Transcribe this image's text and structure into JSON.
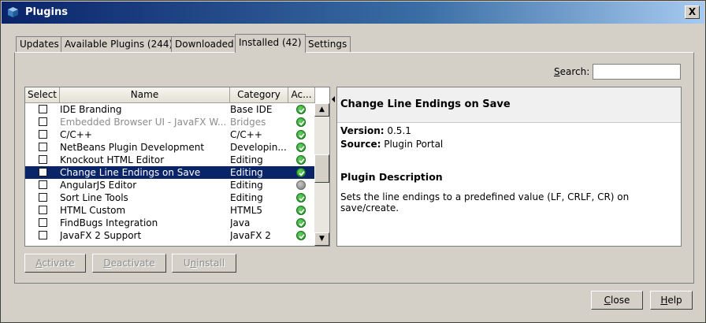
{
  "window": {
    "title": "Plugins",
    "close_label": "X"
  },
  "tabs": [
    {
      "label": "Updates"
    },
    {
      "label": "Available Plugins (244)"
    },
    {
      "label": "Downloaded"
    },
    {
      "label": "Installed (42)"
    },
    {
      "label": "Settings"
    }
  ],
  "search": {
    "label_pre": "",
    "label_mnemonic": "S",
    "label_post": "earch:",
    "value": ""
  },
  "table": {
    "headers": [
      "Select",
      "Name",
      "Category",
      "Ac..."
    ],
    "rows": [
      {
        "name": "IDE Branding",
        "category": "Base IDE",
        "active": true,
        "dimmed": false,
        "selected": false
      },
      {
        "name": "Embedded Browser UI - JavaFX W...",
        "category": "Bridges",
        "active": true,
        "dimmed": true,
        "selected": false
      },
      {
        "name": "C/C++",
        "category": "C/C++",
        "active": true,
        "dimmed": false,
        "selected": false
      },
      {
        "name": "NetBeans Plugin Development",
        "category": "Developin...",
        "active": true,
        "dimmed": false,
        "selected": false
      },
      {
        "name": "Knockout HTML Editor",
        "category": "Editing",
        "active": true,
        "dimmed": false,
        "selected": false
      },
      {
        "name": "Change Line Endings on Save",
        "category": "Editing",
        "active": true,
        "dimmed": false,
        "selected": true
      },
      {
        "name": "AngularJS Editor",
        "category": "Editing",
        "active": false,
        "dimmed": false,
        "selected": false
      },
      {
        "name": "Sort Line Tools",
        "category": "Editing",
        "active": true,
        "dimmed": false,
        "selected": false
      },
      {
        "name": "HTML Custom",
        "category": "HTML5",
        "active": true,
        "dimmed": false,
        "selected": false
      },
      {
        "name": "FindBugs Integration",
        "category": "Java",
        "active": true,
        "dimmed": false,
        "selected": false
      },
      {
        "name": "JavaFX 2 Support",
        "category": "JavaFX 2",
        "active": true,
        "dimmed": false,
        "selected": false
      }
    ]
  },
  "details": {
    "title": "Change Line Endings on Save",
    "version_label": "Version:",
    "version_value": "0.5.1",
    "source_label": "Source:",
    "source_value": "Plugin Portal",
    "section_title": "Plugin Description",
    "description": "Sets the line endings to a predefined value (LF, CRLF, CR) on save/create."
  },
  "actions": {
    "activate": {
      "mnemonic": "A",
      "rest": "ctivate"
    },
    "deactivate": {
      "mnemonic": "D",
      "rest": "eactivate"
    },
    "uninstall": {
      "pre": "U",
      "mnemonic": "n",
      "rest": "install"
    }
  },
  "footer": {
    "close": {
      "mnemonic": "C",
      "rest": "lose"
    },
    "help": {
      "mnemonic": "H",
      "rest": "elp"
    }
  },
  "colors": {
    "title_bar": "#0a246a",
    "selection": "#0a246a",
    "active_dot": "#2ea52e",
    "inactive_dot": "#8a8a8a"
  },
  "icons": {
    "app": "plugin-cube-icon",
    "active": "check-circle-icon",
    "inactive": "grey-circle-icon"
  }
}
